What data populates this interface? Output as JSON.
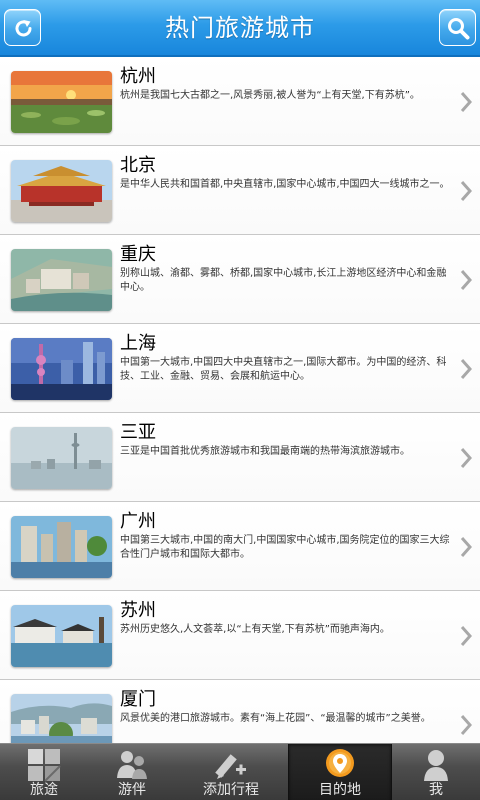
{
  "header": {
    "title": "热门旅游城市",
    "left_icon": "refresh-icon",
    "right_icon": "search-icon",
    "accent": "#2c9be8"
  },
  "cities": [
    {
      "name": "杭州",
      "desc": "杭州是我国七大古都之一,风景秀丽,被人誉为“上有天堂,下有苏杭”。"
    },
    {
      "name": "北京",
      "desc": "是中华人民共和国首都,中央直辖市,国家中心城市,中国四大一线城市之一。"
    },
    {
      "name": "重庆",
      "desc": "别称山城、渝都、雾都、桥都,国家中心城市,长江上游地区经济中心和金融中心。"
    },
    {
      "name": "上海",
      "desc": "中国第一大城市,中国四大中央直辖市之一,国际大都市。为中国的经济、科技、工业、金融、贸易、会展和航运中心。"
    },
    {
      "name": "三亚",
      "desc": "三亚是中国首批优秀旅游城市和我国最南端的热带海滨旅游城市。"
    },
    {
      "name": "广州",
      "desc": "中国第三大城市,中国的南大门,中国国家中心城市,国务院定位的国家三大综合性门户城市和国际大都市。"
    },
    {
      "name": "苏州",
      "desc": "苏州历史悠久,人文荟萃,以“上有天堂,下有苏杭”而驰声海内。"
    },
    {
      "name": "厦门",
      "desc": "风景优美的港口旅游城市。素有“海上花园”、“最温馨的城市”之美誉。"
    }
  ],
  "tabbar": {
    "tabs": [
      {
        "label": "旅途",
        "icon": "grid-icon"
      },
      {
        "label": "游伴",
        "icon": "companions-icon"
      },
      {
        "label": "添加行程",
        "icon": "add-itinerary-icon"
      },
      {
        "label": "目的地",
        "icon": "location-pin-icon",
        "active": true
      },
      {
        "label": "我",
        "icon": "profile-icon"
      }
    ]
  }
}
